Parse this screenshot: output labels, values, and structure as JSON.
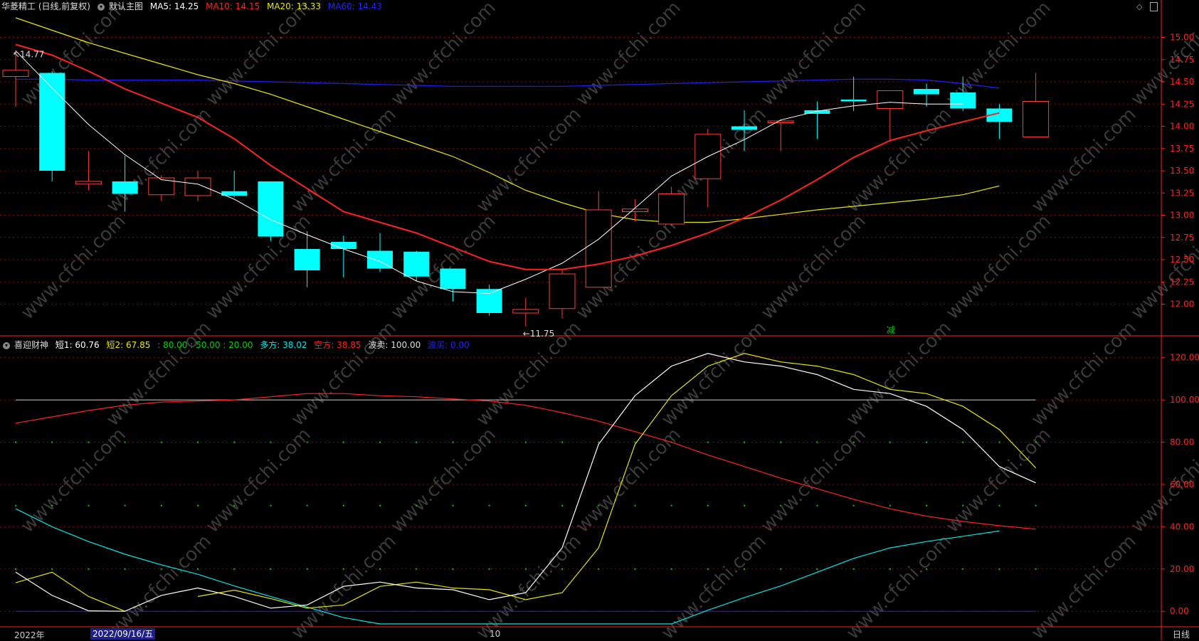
{
  "top_header": {
    "stock_title": "华菱精工 (日线,前复权)",
    "main_chart_label": "默认主图",
    "ma5": "MA5: 14.25",
    "ma10": "MA10: 14.15",
    "ma20": "MA20: 13.33",
    "ma60": "MA60: 14.43"
  },
  "indicator_header": {
    "name": "喜迎财神",
    "short1": "短1: 60.76",
    "short2": "短2: 67.85",
    "levels": ": 80.00 : 50.00 : 20.00",
    "bull": "多方: 38.02",
    "bear": "空方: 38.85",
    "sell": "波卖: 100.00",
    "buy": "波买: 0.00"
  },
  "bottom_bar": {
    "year_label": "2022年",
    "cursor_date": "2022/09/16/五",
    "month_label": "10",
    "period": "日线"
  },
  "colors": {
    "up": "#ff3b3b",
    "down": "#00ffff",
    "ma5": "#ffffff",
    "ma10": "#ff2020",
    "ma20": "#e6e600",
    "ma60": "#2020ff",
    "grid": "#8a0000",
    "axis": "#ff2020",
    "watermark": "#3a3a3a"
  },
  "watermark": "www.cfchi.com",
  "chart_data": [
    {
      "type": "candlestick",
      "title": "华菱精工 (日线,前复权)",
      "y_ticks": [
        15.0,
        14.75,
        14.5,
        14.25,
        14.0,
        13.75,
        13.5,
        13.25,
        13.0,
        12.75,
        12.5,
        12.25,
        12.0
      ],
      "ylim": [
        11.66,
        15.26
      ],
      "candles": [
        {
          "o": 14.56,
          "h": 14.85,
          "l": 14.22,
          "c": 14.63
        },
        {
          "o": 14.6,
          "h": 14.62,
          "l": 13.38,
          "c": 13.5
        },
        {
          "o": 13.35,
          "h": 13.72,
          "l": 13.28,
          "c": 13.38
        },
        {
          "o": 13.38,
          "h": 13.67,
          "l": 13.04,
          "c": 13.24
        },
        {
          "o": 13.23,
          "h": 13.45,
          "l": 13.16,
          "c": 13.42
        },
        {
          "o": 13.22,
          "h": 13.5,
          "l": 13.16,
          "c": 13.42
        },
        {
          "o": 13.27,
          "h": 13.5,
          "l": 13.2,
          "c": 13.22
        },
        {
          "o": 13.38,
          "h": 13.38,
          "l": 12.71,
          "c": 12.76
        },
        {
          "o": 12.62,
          "h": 12.82,
          "l": 12.19,
          "c": 12.38
        },
        {
          "o": 12.7,
          "h": 12.77,
          "l": 12.3,
          "c": 12.62
        },
        {
          "o": 12.6,
          "h": 12.8,
          "l": 12.36,
          "c": 12.4
        },
        {
          "o": 12.59,
          "h": 12.6,
          "l": 12.26,
          "c": 12.31
        },
        {
          "o": 12.4,
          "h": 12.4,
          "l": 12.03,
          "c": 12.17
        },
        {
          "o": 12.17,
          "h": 12.22,
          "l": 11.87,
          "c": 11.9
        },
        {
          "o": 11.9,
          "h": 12.07,
          "l": 11.75,
          "c": 11.94
        },
        {
          "o": 11.95,
          "h": 12.4,
          "l": 11.84,
          "c": 12.34
        },
        {
          "o": 12.19,
          "h": 13.27,
          "l": 12.19,
          "c": 13.06
        },
        {
          "o": 13.04,
          "h": 13.18,
          "l": 12.93,
          "c": 13.07
        },
        {
          "o": 12.9,
          "h": 13.32,
          "l": 12.88,
          "c": 13.24
        },
        {
          "o": 13.41,
          "h": 13.97,
          "l": 13.09,
          "c": 13.91
        },
        {
          "o": 14.0,
          "h": 14.18,
          "l": 13.72,
          "c": 13.96
        },
        {
          "o": 14.04,
          "h": 14.08,
          "l": 13.72,
          "c": 14.06
        },
        {
          "o": 14.18,
          "h": 14.28,
          "l": 13.86,
          "c": 14.14
        },
        {
          "o": 14.3,
          "h": 14.56,
          "l": 14.17,
          "c": 14.28
        },
        {
          "o": 14.2,
          "h": 14.4,
          "l": 13.83,
          "c": 14.4
        },
        {
          "o": 14.42,
          "h": 14.48,
          "l": 14.22,
          "c": 14.36
        },
        {
          "o": 14.38,
          "h": 14.56,
          "l": 14.17,
          "c": 14.2
        },
        {
          "o": 14.2,
          "h": 14.25,
          "l": 13.86,
          "c": 14.05
        },
        {
          "o": 13.88,
          "h": 14.6,
          "l": 13.88,
          "c": 14.28
        }
      ],
      "ma5": [
        14.85,
        14.43,
        14.02,
        13.68,
        13.4,
        13.35,
        13.18,
        12.95,
        12.78,
        12.62,
        12.48,
        12.26,
        12.14,
        12.12,
        12.28,
        12.46,
        12.73,
        13.08,
        13.44,
        13.66,
        13.85,
        14.07,
        14.17,
        14.23,
        14.27,
        14.25,
        14.25
      ],
      "ma10": [
        14.92,
        14.8,
        14.62,
        14.42,
        14.26,
        14.1,
        13.86,
        13.56,
        13.3,
        13.04,
        12.92,
        12.8,
        12.64,
        12.48,
        12.39,
        12.39,
        12.45,
        12.54,
        12.66,
        12.8,
        12.97,
        13.17,
        13.4,
        13.65,
        13.84,
        13.95,
        14.05,
        14.15
      ],
      "ma20": [
        15.22,
        15.08,
        14.94,
        14.82,
        14.7,
        14.58,
        14.48,
        14.36,
        14.22,
        14.08,
        13.94,
        13.8,
        13.66,
        13.48,
        13.28,
        13.14,
        13.02,
        12.95,
        12.92,
        12.92,
        12.96,
        13.01,
        13.06,
        13.1,
        13.14,
        13.18,
        13.23,
        13.33
      ],
      "ma60": [
        14.53,
        14.53,
        14.52,
        14.52,
        14.52,
        14.52,
        14.51,
        14.5,
        14.49,
        14.48,
        14.47,
        14.46,
        14.45,
        14.45,
        14.45,
        14.45,
        14.46,
        14.47,
        14.48,
        14.49,
        14.5,
        14.51,
        14.52,
        14.53,
        14.53,
        14.52,
        14.48,
        14.43
      ],
      "annotations": [
        {
          "label": "14.77",
          "candle": 0,
          "at": "high"
        },
        {
          "label": "11.75",
          "candle": 14,
          "at": "low"
        },
        {
          "label": "减",
          "candle": 24,
          "at": "bottom"
        }
      ]
    },
    {
      "type": "line",
      "title": "喜迎财神",
      "y_ticks": [
        120.0,
        100.0,
        80.0,
        60.0,
        40.0,
        20.0,
        0.0
      ],
      "ylim": [
        -7,
        129
      ],
      "hlines": [
        {
          "value": 100,
          "color": "#cccccc",
          "kind": "line"
        },
        {
          "value": 80,
          "color": "#00cc00",
          "kind": "dots"
        },
        {
          "value": 50,
          "color": "#00cc00",
          "kind": "dots"
        },
        {
          "value": 20,
          "color": "#00cc00",
          "kind": "dots"
        },
        {
          "value": 0,
          "color": "#2020ff",
          "kind": "line"
        }
      ],
      "series": [
        {
          "name": "短1",
          "color": "#ffffff",
          "values": [
            18.5,
            7.5,
            0.2,
            0.0,
            7.5,
            11.0,
            7.0,
            1.5,
            3.0,
            11.8,
            13.8,
            11.0,
            10.2,
            5.5,
            8.8,
            30.0,
            79.0,
            102.0,
            116.0,
            122.0,
            118.0,
            116.0,
            112.0,
            105.0,
            103.0,
            97.0,
            86.0,
            68.5,
            60.76
          ]
        },
        {
          "name": "短2",
          "color": "#e6e600",
          "values": [
            13.5,
            18.5,
            7.0,
            0.0,
            null,
            7.0,
            10.0,
            6.0,
            1.5,
            3.0,
            11.8,
            13.8,
            11.0,
            10.2,
            5.5,
            8.8,
            30.0,
            79.0,
            102.0,
            116.0,
            122.0,
            118.0,
            116.0,
            112.0,
            105.0,
            103.0,
            97.0,
            86.0,
            67.85
          ]
        },
        {
          "name": "空方",
          "color": "#ff2020",
          "values": [
            89.0,
            92.0,
            95.0,
            97.5,
            99.0,
            99.5,
            100.0,
            101.5,
            103.0,
            103.0,
            102.0,
            101.5,
            100.5,
            99.5,
            97.5,
            94.0,
            90.0,
            85.0,
            80.0,
            74.0,
            68.5,
            63.0,
            58.0,
            53.0,
            48.5,
            45.0,
            42.5,
            40.5,
            38.85
          ]
        },
        {
          "name": "多方",
          "color": "#00e5e5",
          "values": [
            48.5,
            40.0,
            33.0,
            27.0,
            22.0,
            17.5,
            12.0,
            7.0,
            2.0,
            -3.0,
            -8.0,
            -12.0,
            -15.0,
            -18.0,
            -18.5,
            -18.5,
            -14.5,
            -11.0,
            -6.0,
            0.5,
            6.5,
            12.0,
            18.5,
            25.0,
            30.0,
            33.0,
            35.5,
            38.02
          ]
        }
      ]
    }
  ]
}
